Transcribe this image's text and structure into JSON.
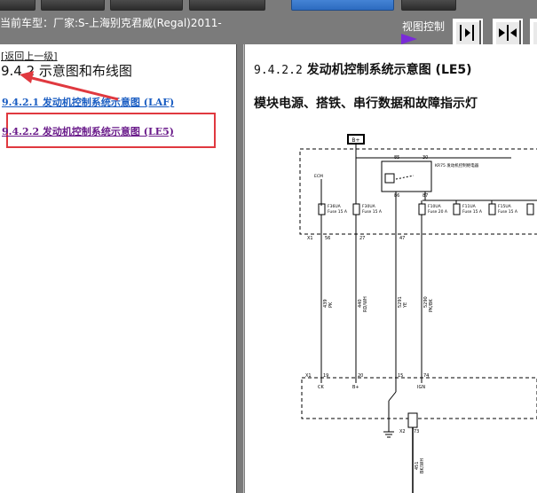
{
  "toolbar": {
    "buttons": [
      "",
      "",
      "",
      "",
      "",
      ""
    ]
  },
  "vehicle_label": "当前车型：厂家:S-上海别克君威(Regal)2011-",
  "view_control": {
    "label": "视图控制",
    "buttons": [
      "collapse-left-icon",
      "split-center-icon",
      "collapse-right-icon"
    ]
  },
  "left": {
    "back_link": "[返回上一级]",
    "title": "9.4.2 示意图和布线图",
    "links": [
      "9.4.2.1 发动机控制系统示意图 (LAF)",
      "9.4.2.2 发动机控制系统示意图 (LE5)"
    ]
  },
  "right": {
    "title_num": "9.4.2.2",
    "title_text": " 发动机控制系统示意图 (LE5)",
    "subtitle": "模块电源、搭铁、串行数据和故障指示灯"
  },
  "diagram": {
    "top_label": "B+",
    "relay_pins": [
      "85",
      "30",
      "86",
      "87"
    ],
    "relay_label": "KR75 发动机控制继电器",
    "fuses": [
      {
        "name": "F36UA",
        "rating": "Fuse 15 A"
      },
      {
        "name": "F30UA",
        "rating": "Fuse 15 A"
      },
      {
        "name": "F10UA",
        "rating": "Fuse 20 A"
      },
      {
        "name": "F11UA",
        "rating": "Fuse 15 A"
      },
      {
        "name": "F15UA",
        "rating": "Fuse 15 A"
      }
    ],
    "x1_pins": [
      "X1",
      "56",
      "27",
      "47"
    ],
    "wires": [
      {
        "num": "439",
        "color": "PK"
      },
      {
        "num": "440",
        "color": "RD/WH"
      },
      {
        "num": "5291",
        "color": "YE"
      },
      {
        "num": "5290",
        "color": "PK/BK"
      }
    ],
    "module_pins": [
      "X1",
      "19",
      "20",
      "15",
      "74"
    ],
    "module_labels": [
      "CK",
      "B+",
      "",
      "IGN"
    ],
    "bottom": [
      "X2",
      "73",
      "451",
      "BK/WH"
    ]
  }
}
